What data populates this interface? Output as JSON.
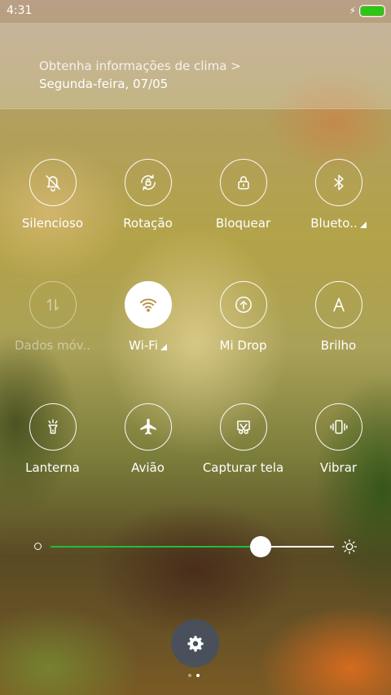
{
  "status_bar": {
    "time": "4:31",
    "battery_color": "#2ac814"
  },
  "weather": {
    "link_text": "Obtenha informações de clima >",
    "date": "Segunda-feira, 07/05"
  },
  "toggles": [
    {
      "label": "Silencioso",
      "icon": "bell-off-icon",
      "state": "off"
    },
    {
      "label": "Rotação",
      "icon": "rotation-lock-icon",
      "state": "off"
    },
    {
      "label": "Bloquear",
      "icon": "lock-icon",
      "state": "off"
    },
    {
      "label": "Blueto..",
      "icon": "bluetooth-icon",
      "state": "off",
      "has_submenu": true
    },
    {
      "label": "Dados móv..",
      "icon": "mobile-data-icon",
      "state": "disabled"
    },
    {
      "label": "Wi-Fi",
      "icon": "wifi-icon",
      "state": "on",
      "has_submenu": true
    },
    {
      "label": "Mi Drop",
      "icon": "mi-drop-icon",
      "state": "off"
    },
    {
      "label": "Brilho",
      "icon": "auto-brightness-icon",
      "state": "off"
    },
    {
      "label": "Lanterna",
      "icon": "flashlight-icon",
      "state": "off"
    },
    {
      "label": "Avião",
      "icon": "airplane-icon",
      "state": "off"
    },
    {
      "label": "Capturar tela",
      "icon": "screenshot-icon",
      "state": "off"
    },
    {
      "label": "Vibrar",
      "icon": "vibrate-icon",
      "state": "off"
    }
  ],
  "brightness": {
    "level": 0.74,
    "fill_color": "#1fbf3b"
  },
  "settings": {
    "icon": "gear-icon"
  },
  "page_indicator": {
    "count": 2,
    "active": 1
  }
}
